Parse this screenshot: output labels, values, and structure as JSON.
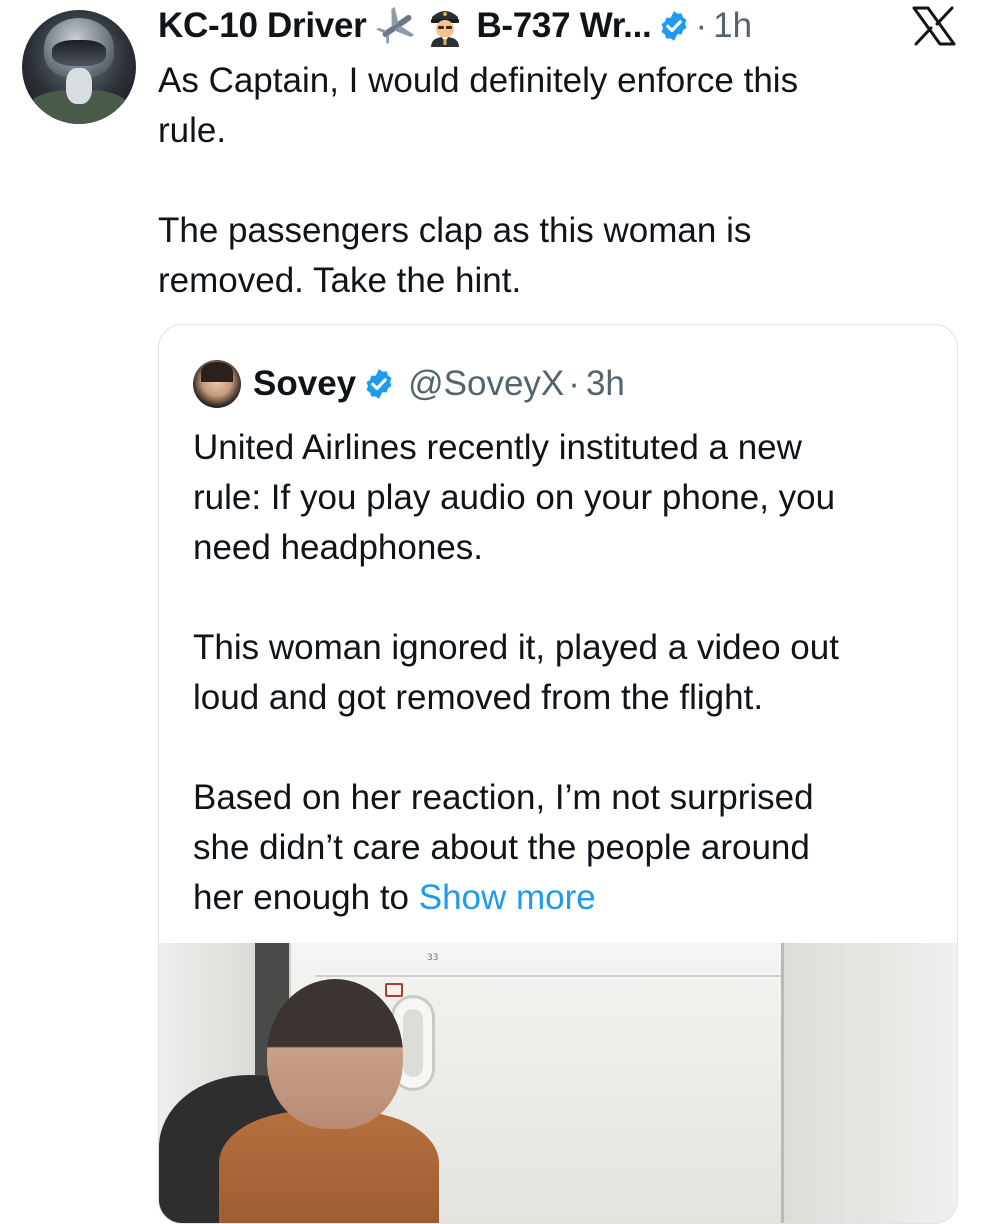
{
  "tweet": {
    "author_name": "KC-10 Driver",
    "author_truncated": "B-737 Wr...",
    "time": "1h",
    "text_lines": [
      "As Captain, I would definitely enforce this",
      "rule.",
      "",
      "The passengers clap as this woman is",
      "removed. Take the hint."
    ],
    "emojis": [
      "airplane-emoji",
      "pilot-emoji"
    ],
    "verified": true
  },
  "quote": {
    "author_name": "Sovey",
    "handle": "@SoveyX",
    "time": "3h",
    "verified": true,
    "text_lines": [
      "United Airlines recently instituted a new",
      "rule: If you play audio on your phone, you",
      "need headphones.",
      "",
      "This woman ignored it, played a video out",
      "loud and got removed from the flight.",
      "",
      "Based on her reaction, I’m not surprised",
      "she didn’t care about the people around"
    ],
    "last_line_prefix": "her enough to ",
    "show_more": "Show more",
    "media_label": "33"
  },
  "separator": "·",
  "colors": {
    "text": "#0f1419",
    "secondary": "#536471",
    "link": "#1d9bf0",
    "verified": "#1d9bf0",
    "border": "#dfe3e6"
  }
}
